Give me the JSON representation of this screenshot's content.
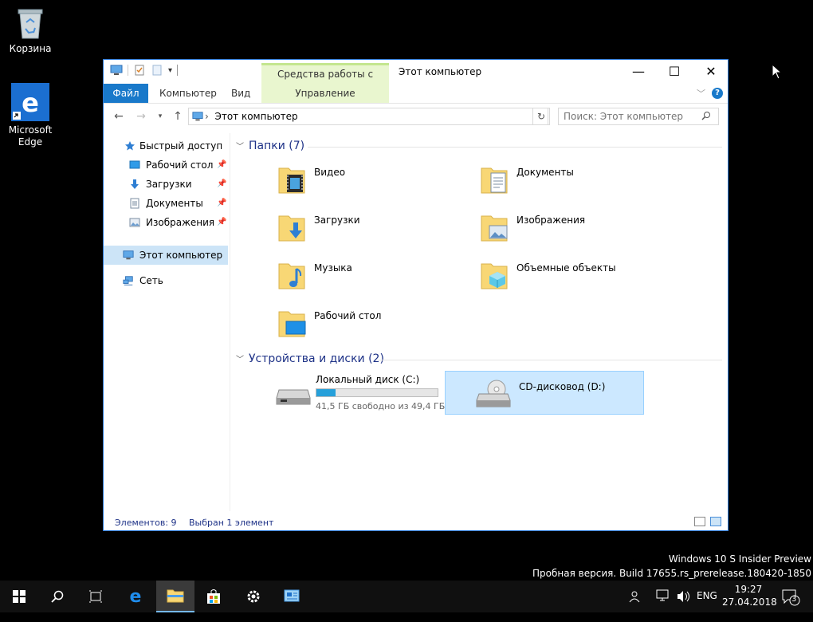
{
  "desktop": {
    "recycle_bin_label": "Корзина",
    "edge_label_1": "Microsoft",
    "edge_label_2": "Edge"
  },
  "window": {
    "title": "Этот компьютер",
    "context_tab_group": "Средства работы с дисками",
    "ribbon_tabs": {
      "file": "Файл",
      "computer": "Компьютер",
      "view": "Вид",
      "manage": "Управление"
    },
    "help": "?"
  },
  "address": {
    "path": "Этот компьютер",
    "search_placeholder": "Поиск: Этот компьютер"
  },
  "sidebar": {
    "quick_access": "Быстрый доступ",
    "items": [
      {
        "label": "Рабочий стол"
      },
      {
        "label": "Загрузки"
      },
      {
        "label": "Документы"
      },
      {
        "label": "Изображения"
      }
    ],
    "this_pc": "Этот компьютер",
    "network": "Сеть"
  },
  "folders_group": {
    "title": "Папки (7)",
    "items": [
      {
        "label": "Видео"
      },
      {
        "label": "Документы"
      },
      {
        "label": "Загрузки"
      },
      {
        "label": "Изображения"
      },
      {
        "label": "Музыка"
      },
      {
        "label": "Объемные объекты"
      },
      {
        "label": "Рабочий стол"
      }
    ]
  },
  "drives_group": {
    "title": "Устройства и диски (2)",
    "local_disk": {
      "name": "Локальный диск (C:)",
      "free_text": "41,5 ГБ свободно из 49,4 ГБ",
      "used_fraction": 0.16
    },
    "cd_drive": {
      "name": "CD-дисковод (D:)"
    }
  },
  "status": {
    "items": "Элементов: 9",
    "selected": "Выбран 1 элемент"
  },
  "watermark": {
    "line1": "Windows 10 S Insider Preview",
    "line2": "Пробная версия. Build 17655.rs_prerelease.180420-1850"
  },
  "taskbar": {
    "language": "ENG",
    "time": "19:27",
    "date": "27.04.2018",
    "notifications": "3"
  },
  "colors": {
    "accent": "#1979ca",
    "selection": "#cce8ff",
    "manage_tab": "#e9f6cf"
  }
}
